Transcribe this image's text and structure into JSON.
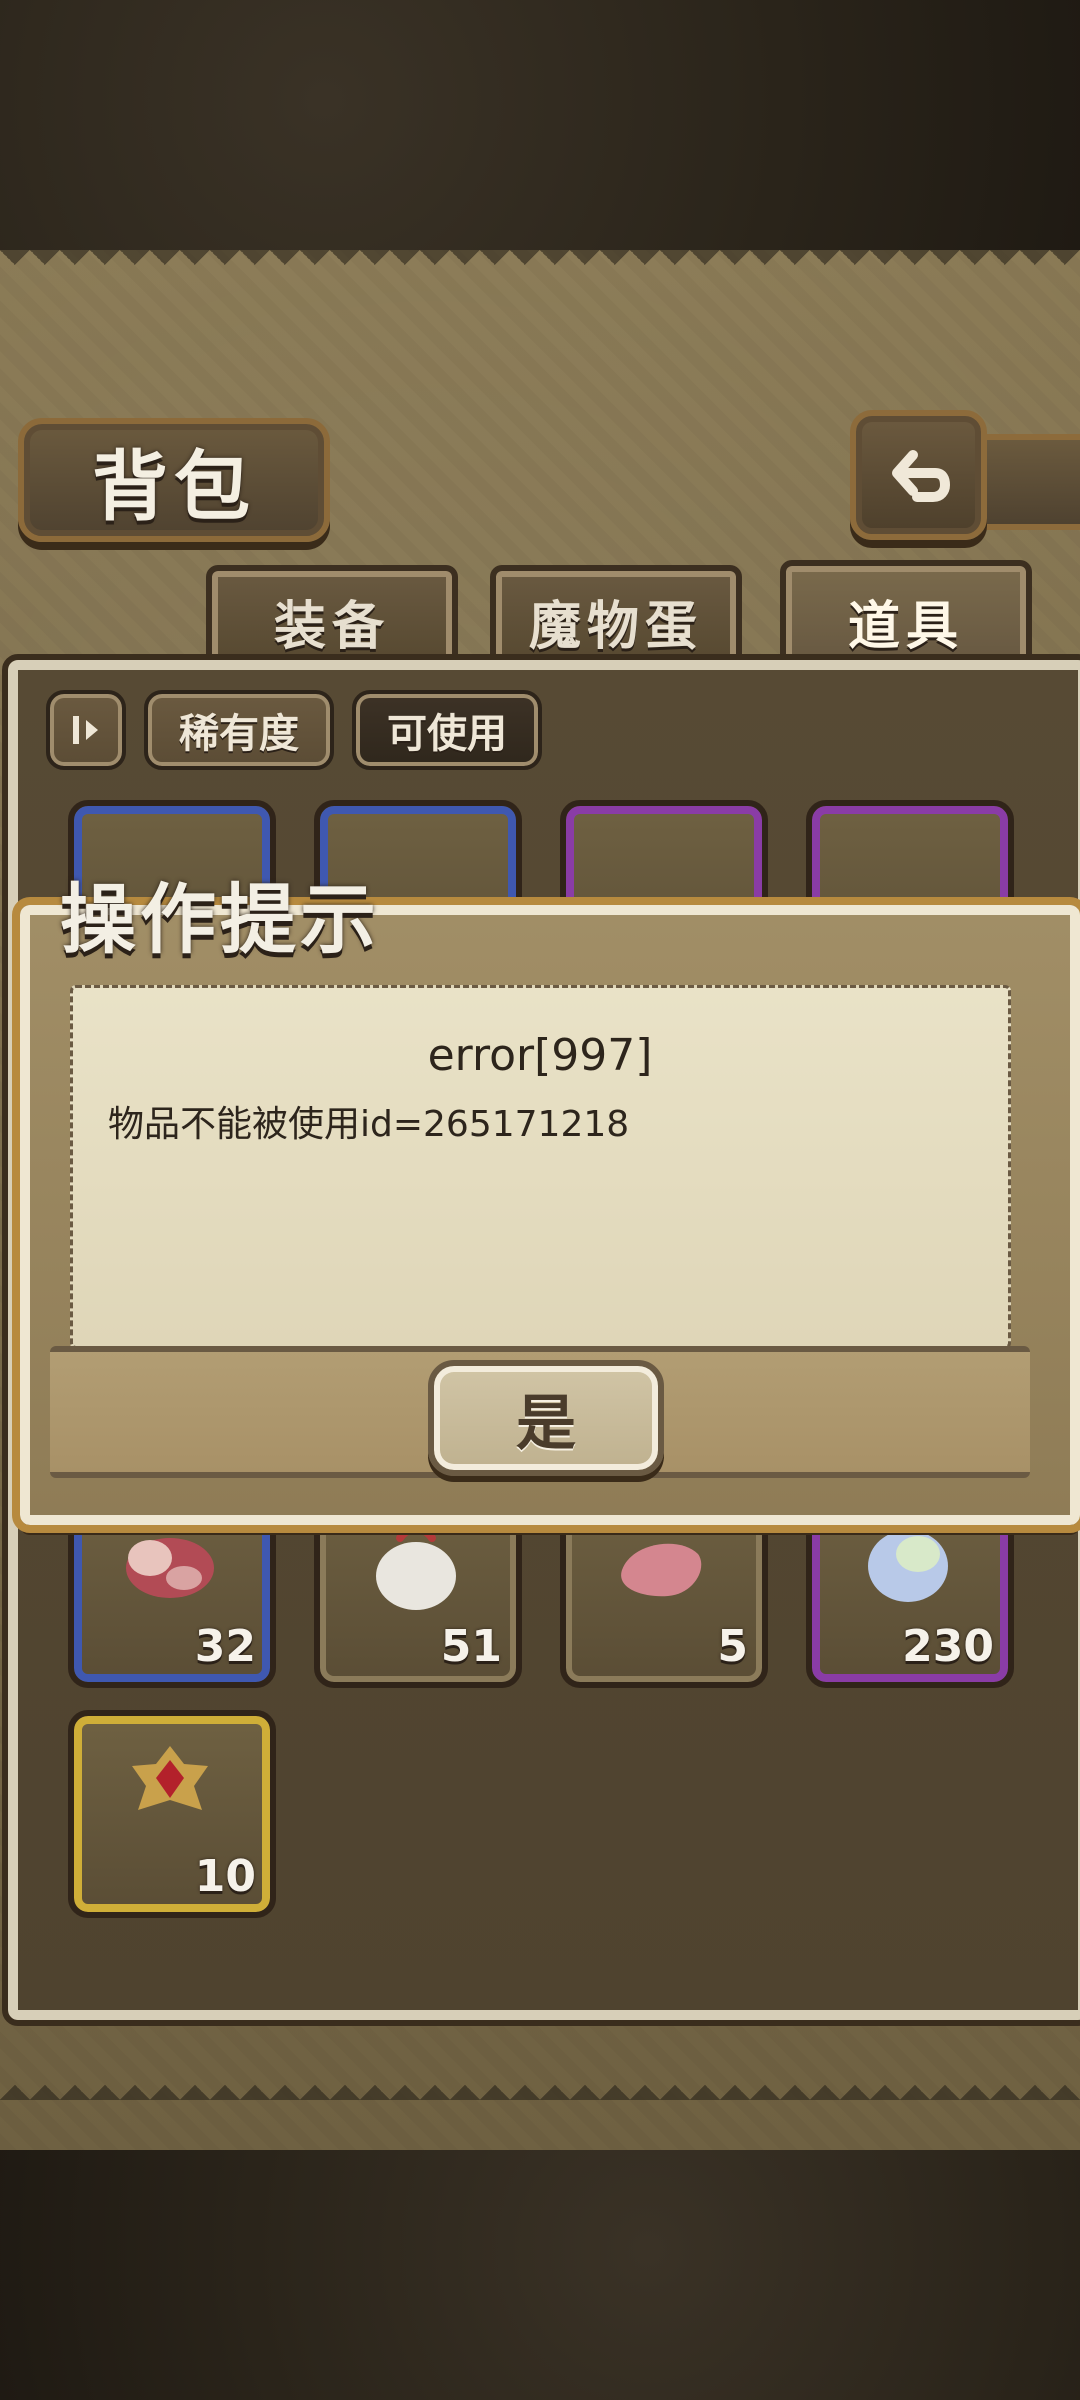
{
  "header": {
    "title": "背包"
  },
  "tabs": [
    {
      "label": "装备"
    },
    {
      "label": "魔物蛋"
    },
    {
      "label": "道具"
    }
  ],
  "filters": {
    "sort_label": "稀有度",
    "usable_label": "可使用"
  },
  "items_bottom_row": [
    {
      "count": "32"
    },
    {
      "count": "51"
    },
    {
      "count": "5"
    },
    {
      "count": "230"
    }
  ],
  "items_last_row": [
    {
      "count": "10"
    }
  ],
  "dialog": {
    "title": "操作提示",
    "error": "error[997]",
    "message": "物品不能被使用id=265171218",
    "confirm_label": "是"
  },
  "icons": {
    "back": "back-arrow-icon",
    "sort_toggle": "sort-toggle-icon"
  }
}
